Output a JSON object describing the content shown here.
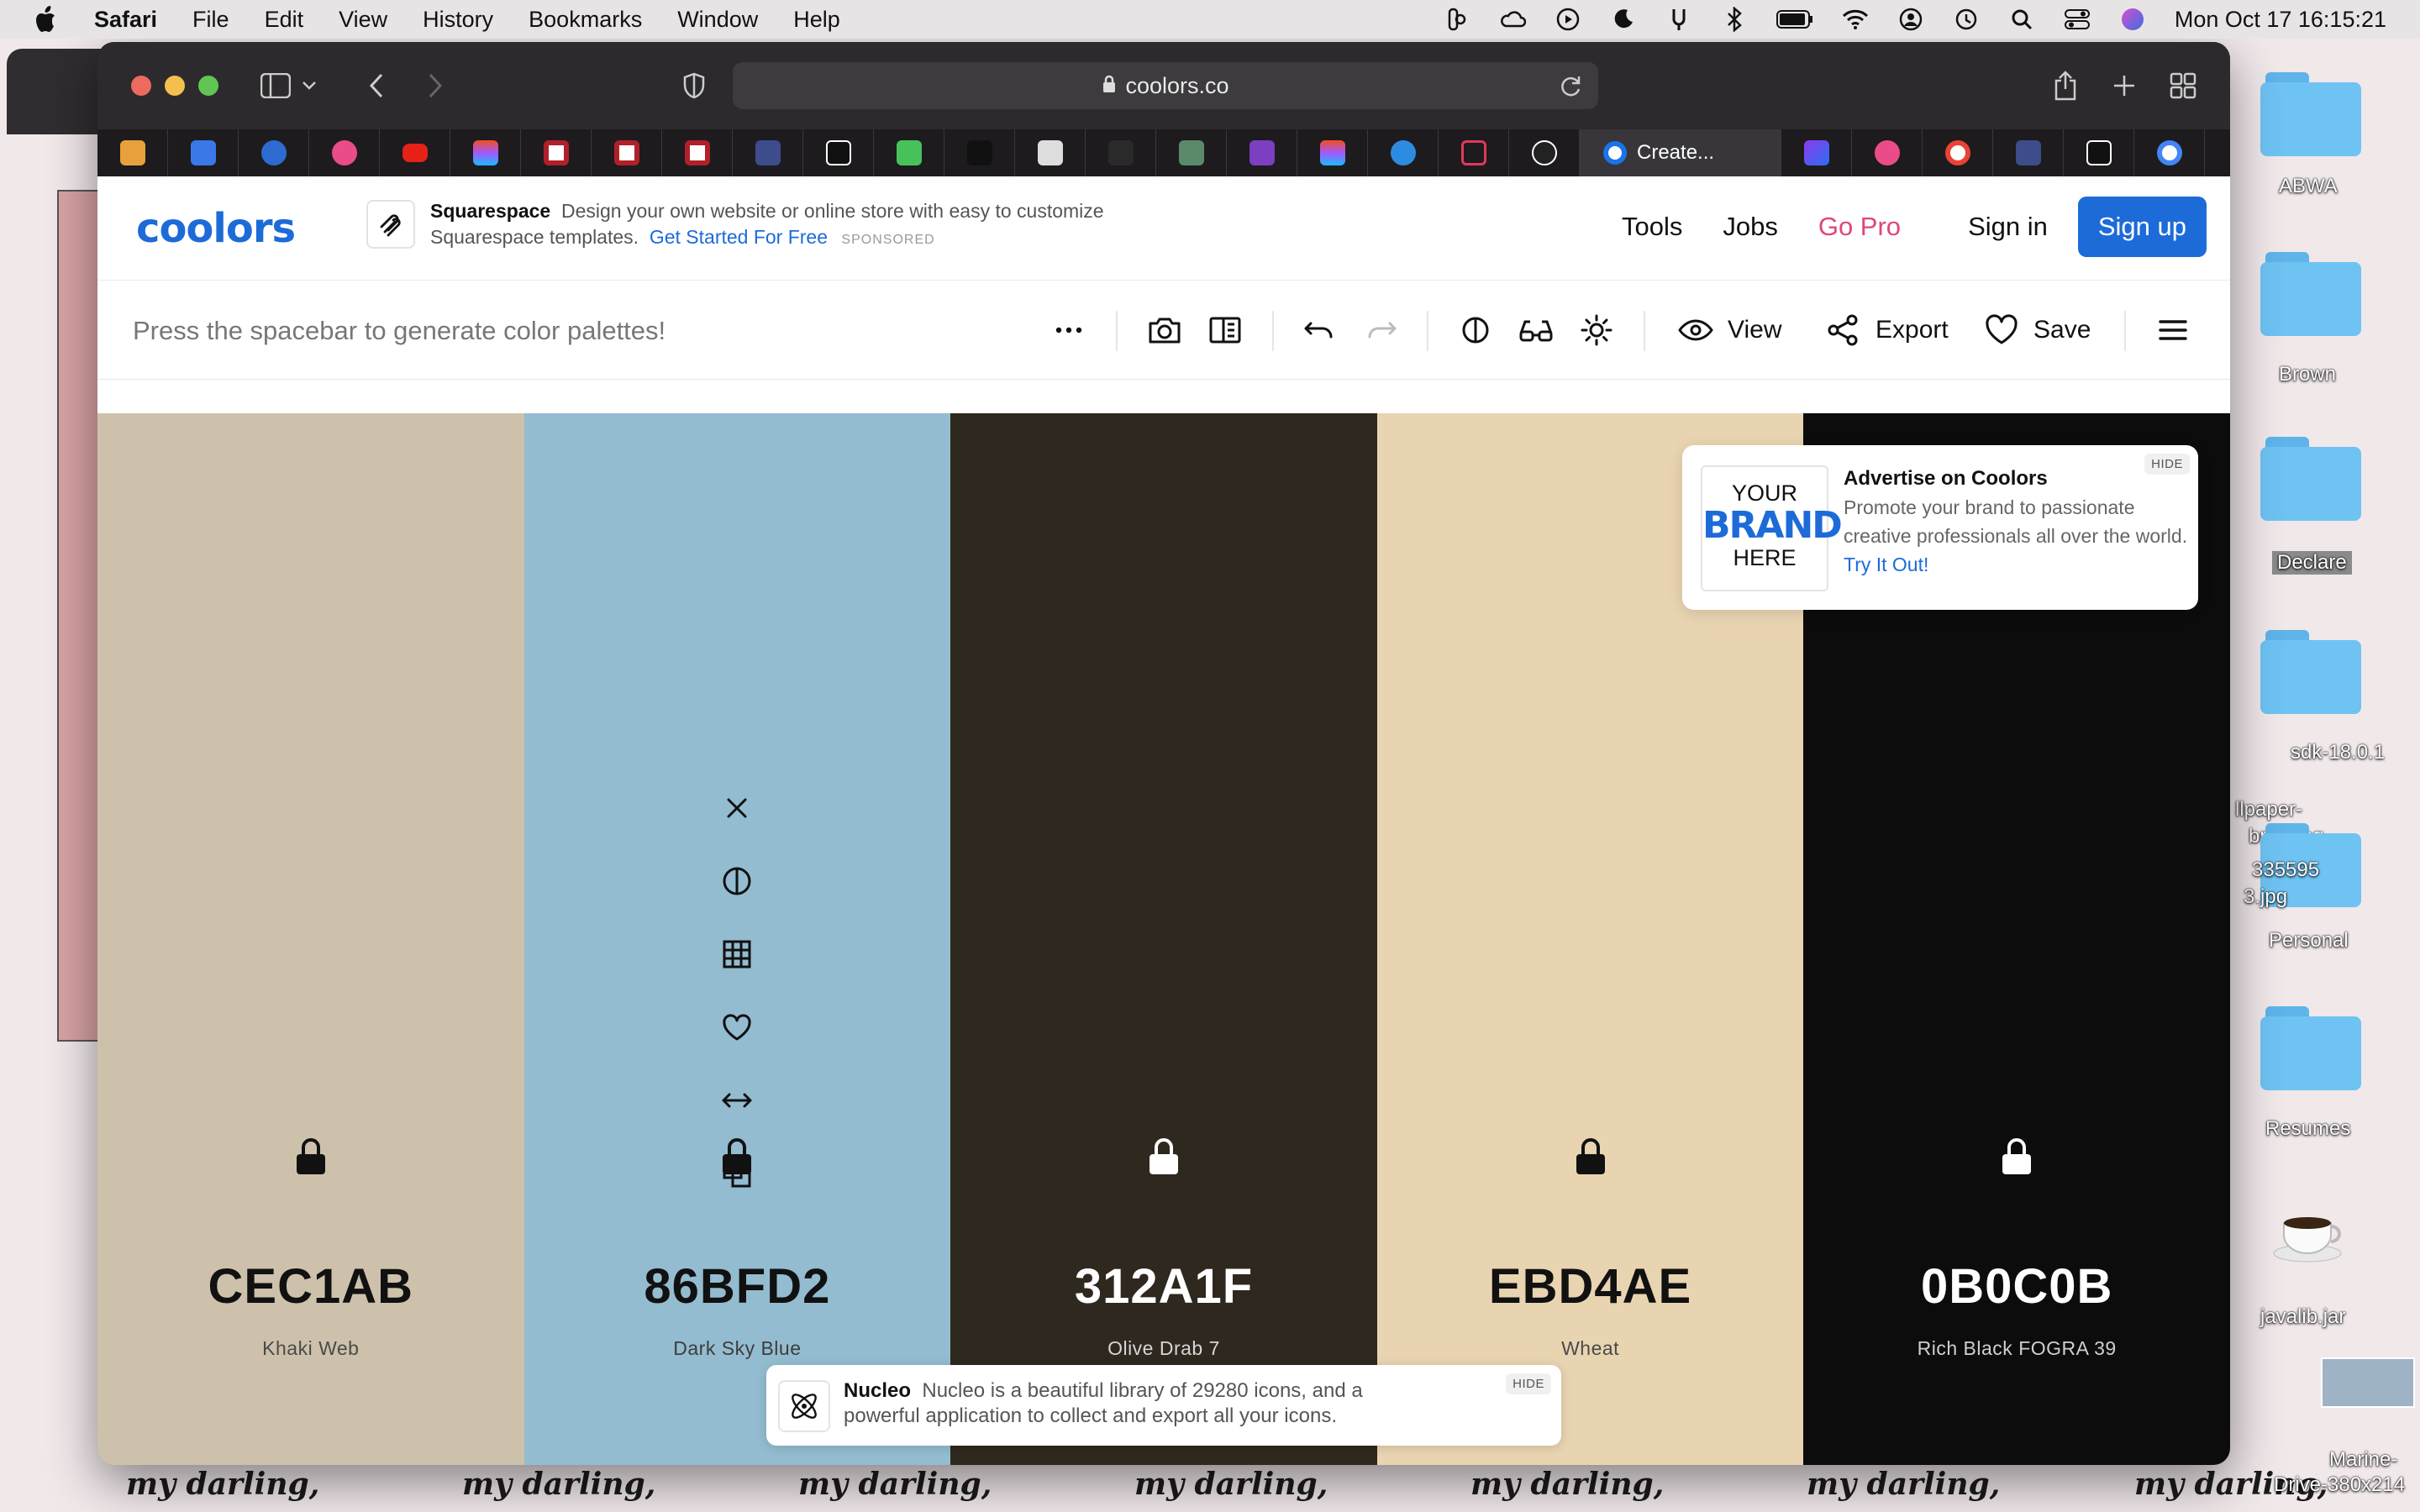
{
  "menubar": {
    "app": "Safari",
    "items": [
      "File",
      "Edit",
      "View",
      "History",
      "Bookmarks",
      "Window",
      "Help"
    ],
    "clock": "Mon Oct 17  16:15:21"
  },
  "browser": {
    "url": "coolors.co",
    "active_tab_title": "Create..."
  },
  "site": {
    "logo": "coolors",
    "sponsor": {
      "name": "Squarespace",
      "text": "Design your own website or online store with easy to customize Squarespace templates.",
      "cta": "Get Started For Free",
      "tag": "SPONSORED"
    },
    "nav": {
      "tools": "Tools",
      "jobs": "Jobs",
      "gopro": "Go Pro",
      "signin": "Sign in",
      "signup": "Sign up"
    }
  },
  "toolbar": {
    "hint": "Press the spacebar to generate color palettes!",
    "view": "View",
    "export": "Export",
    "save": "Save"
  },
  "palette": [
    {
      "hex": "CEC1AB",
      "name": "Khaki Web",
      "bg": "#CEC1AB",
      "fg": "#111111",
      "sub": "#4a4a4a"
    },
    {
      "hex": "86BFD2",
      "name": "Dark Sky Blue",
      "bg": "#93BCD0",
      "fg": "#111111",
      "sub": "#3d3d3d"
    },
    {
      "hex": "312A1F",
      "name": "Olive Drab 7",
      "bg": "#2F281E",
      "fg": "#ffffff",
      "sub": "#d6d6d6"
    },
    {
      "hex": "EBD4AE",
      "name": "Wheat",
      "bg": "#E9D4B1",
      "fg": "#111111",
      "sub": "#4a4a4a"
    },
    {
      "hex": "0B0C0B",
      "name": "Rich Black FOGRA 39",
      "bg": "#0B0C0B",
      "fg": "#ffffff",
      "sub": "#cfcfcf"
    }
  ],
  "ad": {
    "brand_your": "YOUR",
    "brand_brand": "BRAND",
    "brand_here": "HERE",
    "title": "Advertise on Coolors",
    "text": "Promote your brand to passionate creative professionals all over the world.",
    "cta": "Try It Out!",
    "hide": "HIDE"
  },
  "nucleo": {
    "name": "Nucleo",
    "text": "Nucleo is a beautiful library of 29280 icons, and a powerful application to collect and export all your icons.",
    "hide": "HIDE"
  },
  "desktop": {
    "items": [
      "ABWA",
      "Brown",
      "Declare",
      "sdk-18.0.1",
      "llpaper-",
      "bnail.jpg",
      "335595",
      "3.jpg",
      "Personal",
      "Resumes",
      "javalib.jar",
      "Marine-",
      "Drive-380x214"
    ]
  }
}
